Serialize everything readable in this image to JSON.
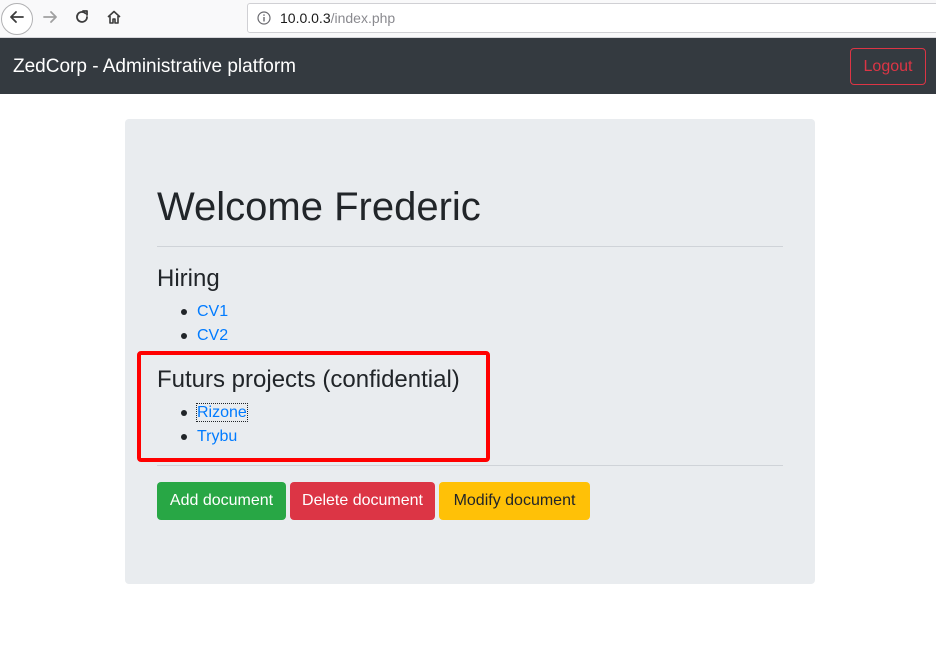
{
  "browser": {
    "url_host": "10.0.0.3",
    "url_path": "/index.php",
    "icons": [
      "back-icon",
      "forward-icon",
      "reload-icon",
      "home-icon",
      "info-icon"
    ]
  },
  "navbar": {
    "brand": "ZedCorp - Administrative platform",
    "logout_label": "Logout"
  },
  "main": {
    "welcome": "Welcome Frederic",
    "sections": [
      {
        "title": "Hiring",
        "items": [
          "CV1",
          "CV2"
        ]
      },
      {
        "title": "Futurs projects (confidential)",
        "items": [
          "Rizone",
          "Trybu"
        ]
      }
    ],
    "actions": {
      "add_label": "Add document",
      "delete_label": "Delete document",
      "modify_label": "Modify document"
    }
  },
  "colors": {
    "navbar_bg": "#343a40",
    "jumbotron_bg": "#e9ecef",
    "link": "#007bff",
    "success": "#28a745",
    "danger": "#dc3545",
    "warning": "#ffc107",
    "highlight": "#ff0000"
  }
}
